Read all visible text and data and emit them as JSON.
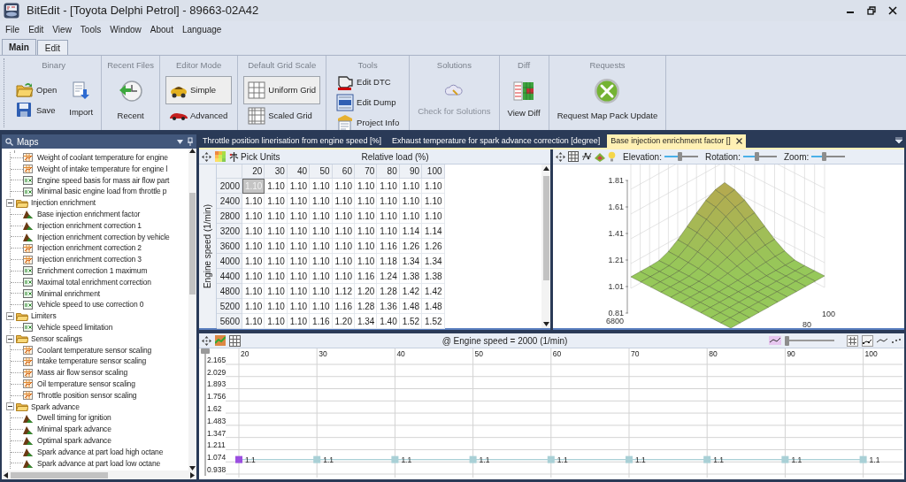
{
  "window": {
    "title": "BitEdit - [Toyota Delphi Petrol] - 89663-02A42"
  },
  "menu": [
    "File",
    "Edit",
    "View",
    "Tools",
    "Window",
    "About",
    "Language"
  ],
  "ribbon_tabs": [
    {
      "label": "Main",
      "selected": true
    },
    {
      "label": "Edit",
      "selected": false
    }
  ],
  "ribbon_groups": [
    {
      "title": "Binary",
      "buttons": [
        {
          "label": "Open",
          "kind": "open",
          "selected": false,
          "disabled": false
        },
        {
          "label": "Save",
          "kind": "save",
          "selected": false,
          "disabled": false
        },
        {
          "label": "Import",
          "kind": "import",
          "selected": false,
          "disabled": false
        }
      ]
    },
    {
      "title": "Recent Files",
      "buttons": [
        {
          "label": "Recent",
          "kind": "recent",
          "selected": false,
          "disabled": false
        }
      ]
    },
    {
      "title": "Editor Mode",
      "buttons": [
        {
          "label": "Simple",
          "kind": "simple",
          "selected": true,
          "disabled": false
        },
        {
          "label": "Advanced",
          "kind": "advanced",
          "selected": false,
          "disabled": false
        }
      ]
    },
    {
      "title": "Default Grid Scale",
      "buttons": [
        {
          "label": "Uniform Grid",
          "kind": "uniform",
          "selected": true,
          "disabled": false
        },
        {
          "label": "Scaled Grid",
          "kind": "scaled",
          "selected": false,
          "disabled": false
        }
      ]
    },
    {
      "title": "Tools",
      "buttons": [
        {
          "label": "Edit DTC",
          "kind": "dtc",
          "selected": false,
          "disabled": false
        },
        {
          "label": "Edit Dump",
          "kind": "dump",
          "selected": false,
          "disabled": false
        },
        {
          "label": "Project Info",
          "kind": "info",
          "selected": false,
          "disabled": false
        }
      ]
    },
    {
      "title": "Solutions",
      "buttons": [
        {
          "label": "Check for Solutions",
          "kind": "solutions",
          "selected": false,
          "disabled": true
        }
      ]
    },
    {
      "title": "Diff",
      "buttons": [
        {
          "label": "View Diff",
          "kind": "diff",
          "selected": false,
          "disabled": false
        }
      ]
    },
    {
      "title": "Requests",
      "buttons": [
        {
          "label": "Request Map Pack Update",
          "kind": "request",
          "selected": false,
          "disabled": false
        }
      ]
    }
  ],
  "maps_panel": {
    "title": "Maps",
    "tree": [
      {
        "label": "Weight of coolant temperature for engine",
        "kind": "table2d"
      },
      {
        "label": "Weight of intake temperature for engine l",
        "kind": "table2d"
      },
      {
        "label": "Engine speed basis for mass air flow part",
        "kind": "table1d"
      },
      {
        "label": "Minimal basic engine load from throttle p",
        "kind": "table1d"
      },
      {
        "label": "Injection enrichment",
        "kind": "folder",
        "expanded": true,
        "children": [
          {
            "label": "Base injection enrichment factor",
            "kind": "map3d"
          },
          {
            "label": "Injection enrichment correction 1",
            "kind": "map3d"
          },
          {
            "label": "Injection enrichment correction by vehicle",
            "kind": "map3d"
          },
          {
            "label": "Injection enrichment correction 2",
            "kind": "table2d"
          },
          {
            "label": "Injection enrichment correction 3",
            "kind": "table2d"
          },
          {
            "label": "Enrichment correction 1 maximum",
            "kind": "table1d"
          },
          {
            "label": "Maximal total enrichment correction",
            "kind": "table1d"
          },
          {
            "label": "Minimal enrichment",
            "kind": "table1d"
          },
          {
            "label": "Vehicle speed to use correction 0",
            "kind": "table1d"
          }
        ]
      },
      {
        "label": "Limiters",
        "kind": "folder",
        "expanded": true,
        "children": [
          {
            "label": "Vehicle speed limitation",
            "kind": "table1d"
          }
        ]
      },
      {
        "label": "Sensor scalings",
        "kind": "folder",
        "expanded": true,
        "children": [
          {
            "label": "Coolant temperature sensor scaling",
            "kind": "table2d"
          },
          {
            "label": "Intake temperature sensor scaling",
            "kind": "table2d"
          },
          {
            "label": "Mass air flow sensor scaling",
            "kind": "table2d"
          },
          {
            "label": "Oil temperature sensor scaling",
            "kind": "table2d"
          },
          {
            "label": "Throttle position sensor scaling",
            "kind": "table2d"
          }
        ]
      },
      {
        "label": "Spark advance",
        "kind": "folder",
        "expanded": true,
        "children": [
          {
            "label": "Dwell timing for ignition",
            "kind": "map3d"
          },
          {
            "label": "Minimal spark advance",
            "kind": "map3d"
          },
          {
            "label": "Optimal spark advance",
            "kind": "map3d"
          },
          {
            "label": "Spark advance at part load high octane",
            "kind": "map3d"
          },
          {
            "label": "Spark advance at part load low octane",
            "kind": "map3d"
          }
        ]
      }
    ]
  },
  "document_tabs": [
    {
      "label": "Throttle position linerisation from engine speed [%]",
      "selected": false
    },
    {
      "label": "Exhaust temperature for spark advance correction [degree]",
      "selected": false
    },
    {
      "label": "Base injection enrichment factor []",
      "selected": true
    }
  ],
  "table_panel": {
    "pick_units": "Pick Units",
    "x_title": "Relative load (%)",
    "y_title": "Engine speed (1/min)",
    "columns": [
      "20",
      "30",
      "40",
      "50",
      "60",
      "70",
      "80",
      "90",
      "100"
    ],
    "rows": [
      {
        "label": "2000",
        "cells": [
          {
            "value": "1.10",
            "selected": true
          },
          {
            "value": "1.10",
            "selected": false
          },
          {
            "value": "1.10",
            "selected": false
          },
          {
            "value": "1.10",
            "selected": false
          },
          {
            "value": "1.10",
            "selected": false
          },
          {
            "value": "1.10",
            "selected": false
          },
          {
            "value": "1.10",
            "selected": false
          },
          {
            "value": "1.10",
            "selected": false
          },
          {
            "value": "1.10",
            "selected": false
          }
        ]
      },
      {
        "label": "2400",
        "cells": [
          {
            "value": "1.10",
            "selected": false
          },
          {
            "value": "1.10",
            "selected": false
          },
          {
            "value": "1.10",
            "selected": false
          },
          {
            "value": "1.10",
            "selected": false
          },
          {
            "value": "1.10",
            "selected": false
          },
          {
            "value": "1.10",
            "selected": false
          },
          {
            "value": "1.10",
            "selected": false
          },
          {
            "value": "1.10",
            "selected": false
          },
          {
            "value": "1.10",
            "selected": false
          }
        ]
      },
      {
        "label": "2800",
        "cells": [
          {
            "value": "1.10",
            "selected": false
          },
          {
            "value": "1.10",
            "selected": false
          },
          {
            "value": "1.10",
            "selected": false
          },
          {
            "value": "1.10",
            "selected": false
          },
          {
            "value": "1.10",
            "selected": false
          },
          {
            "value": "1.10",
            "selected": false
          },
          {
            "value": "1.10",
            "selected": false
          },
          {
            "value": "1.10",
            "selected": false
          },
          {
            "value": "1.10",
            "selected": false
          }
        ]
      },
      {
        "label": "3200",
        "cells": [
          {
            "value": "1.10",
            "selected": false
          },
          {
            "value": "1.10",
            "selected": false
          },
          {
            "value": "1.10",
            "selected": false
          },
          {
            "value": "1.10",
            "selected": false
          },
          {
            "value": "1.10",
            "selected": false
          },
          {
            "value": "1.10",
            "selected": false
          },
          {
            "value": "1.10",
            "selected": false
          },
          {
            "value": "1.14",
            "selected": false
          },
          {
            "value": "1.14",
            "selected": false
          }
        ]
      },
      {
        "label": "3600",
        "cells": [
          {
            "value": "1.10",
            "selected": false
          },
          {
            "value": "1.10",
            "selected": false
          },
          {
            "value": "1.10",
            "selected": false
          },
          {
            "value": "1.10",
            "selected": false
          },
          {
            "value": "1.10",
            "selected": false
          },
          {
            "value": "1.10",
            "selected": false
          },
          {
            "value": "1.16",
            "selected": false
          },
          {
            "value": "1.26",
            "selected": false
          },
          {
            "value": "1.26",
            "selected": false
          }
        ]
      },
      {
        "label": "4000",
        "cells": [
          {
            "value": "1.10",
            "selected": false
          },
          {
            "value": "1.10",
            "selected": false
          },
          {
            "value": "1.10",
            "selected": false
          },
          {
            "value": "1.10",
            "selected": false
          },
          {
            "value": "1.10",
            "selected": false
          },
          {
            "value": "1.10",
            "selected": false
          },
          {
            "value": "1.18",
            "selected": false
          },
          {
            "value": "1.34",
            "selected": false
          },
          {
            "value": "1.34",
            "selected": false
          }
        ]
      },
      {
        "label": "4400",
        "cells": [
          {
            "value": "1.10",
            "selected": false
          },
          {
            "value": "1.10",
            "selected": false
          },
          {
            "value": "1.10",
            "selected": false
          },
          {
            "value": "1.10",
            "selected": false
          },
          {
            "value": "1.10",
            "selected": false
          },
          {
            "value": "1.16",
            "selected": false
          },
          {
            "value": "1.24",
            "selected": false
          },
          {
            "value": "1.38",
            "selected": false
          },
          {
            "value": "1.38",
            "selected": false
          }
        ]
      },
      {
        "label": "4800",
        "cells": [
          {
            "value": "1.10",
            "selected": false
          },
          {
            "value": "1.10",
            "selected": false
          },
          {
            "value": "1.10",
            "selected": false
          },
          {
            "value": "1.10",
            "selected": false
          },
          {
            "value": "1.12",
            "selected": false
          },
          {
            "value": "1.20",
            "selected": false
          },
          {
            "value": "1.28",
            "selected": false
          },
          {
            "value": "1.42",
            "selected": false
          },
          {
            "value": "1.42",
            "selected": false
          }
        ]
      },
      {
        "label": "5200",
        "cells": [
          {
            "value": "1.10",
            "selected": false
          },
          {
            "value": "1.10",
            "selected": false
          },
          {
            "value": "1.10",
            "selected": false
          },
          {
            "value": "1.10",
            "selected": false
          },
          {
            "value": "1.16",
            "selected": false
          },
          {
            "value": "1.28",
            "selected": false
          },
          {
            "value": "1.36",
            "selected": false
          },
          {
            "value": "1.48",
            "selected": false
          },
          {
            "value": "1.48",
            "selected": false
          }
        ]
      },
      {
        "label": "5600",
        "cells": [
          {
            "value": "1.10",
            "selected": false
          },
          {
            "value": "1.10",
            "selected": false
          },
          {
            "value": "1.10",
            "selected": false
          },
          {
            "value": "1.16",
            "selected": false
          },
          {
            "value": "1.20",
            "selected": false
          },
          {
            "value": "1.34",
            "selected": false
          },
          {
            "value": "1.40",
            "selected": false
          },
          {
            "value": "1.52",
            "selected": false
          },
          {
            "value": "1.52",
            "selected": false
          }
        ]
      }
    ]
  },
  "surface_panel": {
    "sliders": [
      {
        "label": "Elevation:",
        "level": 0.45
      },
      {
        "label": "Rotation:",
        "level": 0.4
      },
      {
        "label": "Zoom:",
        "level": 0.35
      }
    ],
    "z_ticks": [
      "1.81",
      "1.61",
      "1.41",
      "1.21",
      "1.01",
      "0.81"
    ],
    "speed_tick": "6800",
    "load_ticks": [
      "100",
      "80"
    ]
  },
  "line_panel": {
    "title": "@ Engine speed = 2000 (1/min)",
    "slider": {
      "level": 0
    },
    "chart_data": {
      "type": "line",
      "categories": [
        "20",
        "30",
        "40",
        "50",
        "60",
        "70",
        "80",
        "90",
        "100"
      ],
      "grid": true,
      "series": [
        {
          "color": "#a9d0d6",
          "marker": "square",
          "values": [
            1.1,
            1.1,
            1.1,
            1.1,
            1.1,
            1.1,
            1.1,
            1.1,
            1.1
          ]
        }
      ],
      "ylim": [
        0.938,
        2.165
      ],
      "yticks": [
        {
          "value": 2.165,
          "label": "2.165"
        },
        {
          "value": 2.029,
          "label": "2.029"
        },
        {
          "value": 1.893,
          "label": "1.893"
        },
        {
          "value": 1.756,
          "label": "1.756"
        },
        {
          "value": 1.62,
          "label": "1.62"
        },
        {
          "value": 1.483,
          "label": "1.483"
        },
        {
          "value": 1.347,
          "label": "1.347"
        },
        {
          "value": 1.211,
          "label": "1.211"
        },
        {
          "value": 1.074,
          "label": "1.074"
        },
        {
          "value": 0.938,
          "label": "0.938"
        }
      ],
      "data_labels": true
    }
  }
}
